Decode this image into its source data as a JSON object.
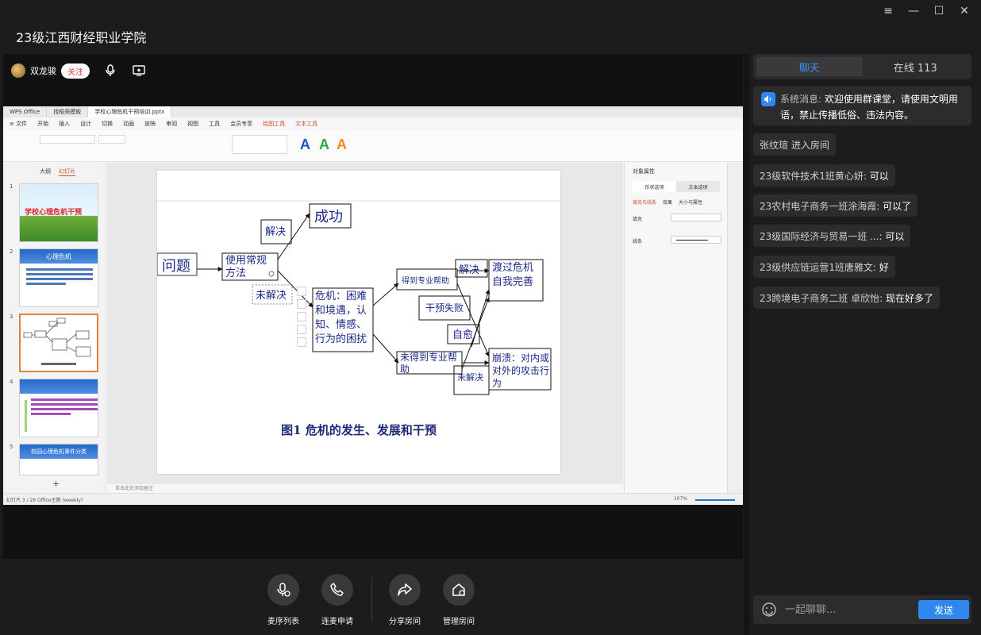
{
  "window": {
    "title": "23级江西财经职业学院",
    "controls": [
      "≡",
      "—",
      "☐",
      "✕"
    ]
  },
  "host": {
    "name": "双龙骏",
    "follow_label": "关注"
  },
  "share": {
    "wps_tabs": [
      "WPS Office",
      "找稻壳模板",
      "学校心理危机干预培训.pptx"
    ],
    "menu": [
      "≡ 文件",
      "开始",
      "插入",
      "设计",
      "切换",
      "动画",
      "放映",
      "审阅",
      "视图",
      "工具",
      "会员专享",
      "绘图工具",
      "文本工具"
    ],
    "thumb_tabs": [
      "大纲",
      "幻灯片"
    ],
    "thumbnails": [
      {
        "num": "1",
        "title": "学校心理危机干预"
      },
      {
        "num": "2",
        "title": "心理危机"
      },
      {
        "num": "3",
        "title": ""
      },
      {
        "num": "4",
        "title": ""
      },
      {
        "num": "5",
        "title": "校园心理危机事件分类"
      }
    ],
    "slide": {
      "nodes": {
        "problem": "问题",
        "method": "使用常规方法",
        "solved": "解决",
        "success": "成功",
        "unsolved": "未解决",
        "crisis": "危机：困难和境遇，认知、情感、行为的困扰",
        "get_help": "得到专业帮助",
        "no_help": "未得到专业帮助",
        "solved2": "解决",
        "overcome": "渡过危机自我完善",
        "fail": "干预失败",
        "self_heal": "自愈",
        "collapse": "崩溃：对内或对外的攻击行为",
        "unsolved2": "未解决"
      },
      "caption": "图1  危机的发生、发展和干预"
    },
    "notes_placeholder": "单击此处添加备注",
    "right_panel": {
      "title": "对象属性",
      "tabs": [
        "形状选项",
        "文本选项"
      ],
      "subtabs": [
        "填充与线条",
        "效果",
        "大小与属性"
      ],
      "rows": [
        "填充",
        "线条"
      ]
    },
    "status": {
      "left": "幻灯片 3 / 26    Office主题    (weekly)",
      "zoom": "107%"
    }
  },
  "toolbar": {
    "items": [
      {
        "label": "麦序列表",
        "icon": "mic-list-icon"
      },
      {
        "label": "连麦申请",
        "icon": "phone-icon"
      },
      {
        "label": "分享房间",
        "icon": "share-icon"
      },
      {
        "label": "管理房间",
        "icon": "manage-icon"
      }
    ]
  },
  "chat": {
    "tabs": [
      "聊天",
      "在线 113"
    ],
    "system": {
      "label": "系统消息:",
      "text": "欢迎使用群课堂，请使用文明用语，禁止传播低俗、违法内容。"
    },
    "messages": [
      {
        "sender": "张纹瑄 进入房间",
        "text": ""
      },
      {
        "sender": "23级软件技术1班黄心妍:",
        "text": "可以"
      },
      {
        "sender": "23农村电子商务一班涂海霞:",
        "text": "可以了"
      },
      {
        "sender": "23级国际经济与贸易一班 ...:",
        "text": "可以"
      },
      {
        "sender": "23级供应链运营1班唐雅文:",
        "text": "好"
      },
      {
        "sender": "23跨境电子商务二班 卓欣怡:",
        "text": "现在好多了"
      }
    ],
    "input_placeholder": "一起聊聊...",
    "send_label": "发送"
  },
  "colors": {
    "accent": "#2f88f0",
    "background": "#1c1c1e",
    "bubble": "#2c2c2e"
  }
}
